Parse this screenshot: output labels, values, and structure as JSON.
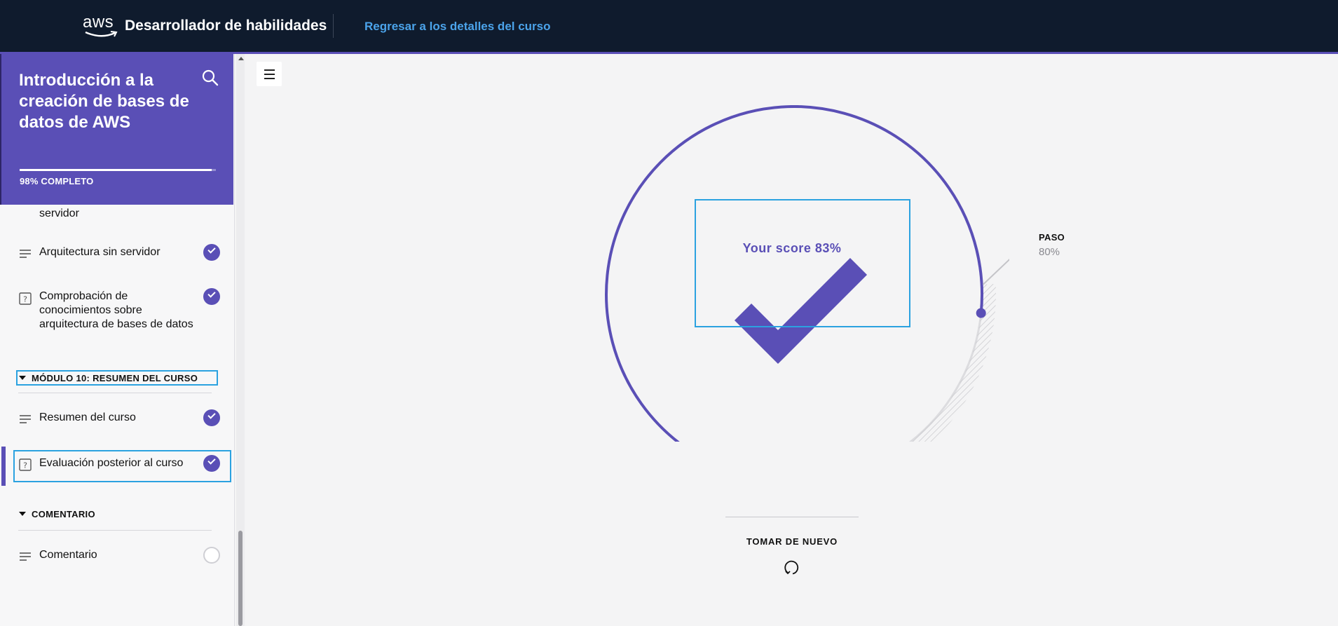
{
  "header": {
    "logo_text": "aws",
    "app_title": "Desarrollador de habilidades",
    "back_link": "Regresar a los detalles del curso"
  },
  "sidebar": {
    "course_title": "Introducción a la creación de bases de datos de AWS",
    "progress_label": "98% COMPLETO",
    "progress_fraction": 0.98,
    "lessons": [
      {
        "label": "servidor",
        "icon": "lines-icon",
        "status": "complete"
      },
      {
        "label": "Arquitectura sin servidor",
        "icon": "lines-icon",
        "status": "complete"
      },
      {
        "label": "Comprobación de conocimientos sobre arquitectura de bases de datos",
        "icon": "quiz-icon",
        "status": "complete"
      }
    ],
    "section_module10": {
      "label": "MÓDULO 10: RESUMEN DEL CURSO",
      "lessons": [
        {
          "label": "Resumen del curso",
          "icon": "lines-icon",
          "status": "complete"
        },
        {
          "label": "Evaluación posterior al curso",
          "icon": "quiz-icon",
          "status": "complete",
          "active": true
        }
      ]
    },
    "section_feedback": {
      "label": "COMENTARIO",
      "lessons": [
        {
          "label": "Comentario",
          "icon": "lines-icon",
          "status": "incomplete"
        }
      ]
    }
  },
  "result": {
    "score_text": "Your score 83%",
    "score_fraction": 0.83,
    "pass_label": "PASO",
    "pass_value": "80%",
    "pass_fraction": 0.8,
    "retake_label": "TOMAR DE NUEVO"
  },
  "colors": {
    "accent": "#5a4fb6",
    "topbar": "#0f1b2d",
    "link": "#4ba3ea",
    "highlight": "#2ba2e0"
  }
}
